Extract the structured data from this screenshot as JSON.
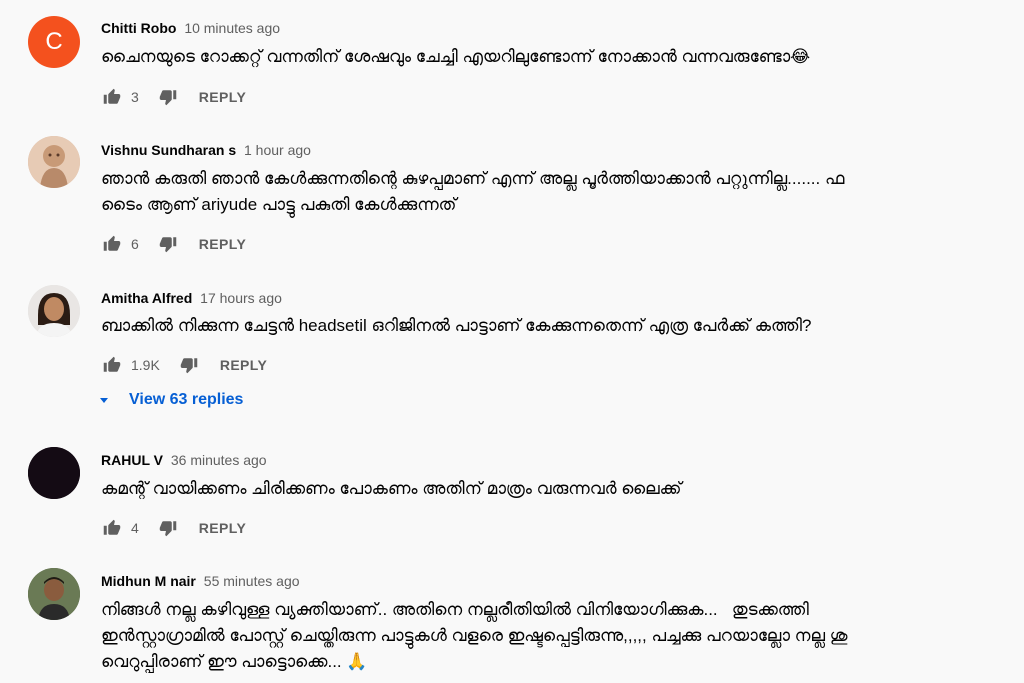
{
  "comments": [
    {
      "avatar_letter": "C",
      "author": "Chitti Robo",
      "time": "10 minutes ago",
      "text": "ചൈനയുടെ റോക്കറ്റ് വന്നതിന് ശേഷവും ചേച്ചി എയറിലുണ്ടോന്ന് നോക്കാൻ വന്നവരുണ്ടോ😂",
      "likes": "3",
      "reply_label": "REPLY"
    },
    {
      "author": "Vishnu Sundharan s",
      "time": "1 hour ago",
      "text": "ഞാൻ കരുതി ഞാൻ കേൾക്കുന്നതിന്റെ കുഴപ്പമാണ് എന്ന് അല്ല പൂർത്തിയാക്കാൻ പറ്റുന്നില്ല....... ഫ\nടൈം ആണ് ariyude പാട്ടു പകുതി കേൾക്കുന്നത്",
      "likes": "6",
      "reply_label": "REPLY"
    },
    {
      "author": "Amitha Alfred",
      "time": "17 hours ago",
      "text": "ബാക്കിൽ നിക്കുന്ന ചേട്ടൻ headsetil ഒറിജിനൽ പാട്ടാണ് കേക്കുന്നതെന്ന് എത്ര പേർക്ക് കത്തി?",
      "likes": "1.9K",
      "reply_label": "REPLY",
      "view_replies": "View 63 replies"
    },
    {
      "author": "RAHUL V",
      "time": "36 minutes ago",
      "text": "കമന്റ് വായിക്കണം ചിരിക്കണം പോകണം അതിന് മാത്രം വരുന്നവർ ലൈക്ക്",
      "likes": "4",
      "reply_label": "REPLY"
    },
    {
      "author": "Midhun M nair",
      "time": "55 minutes ago",
      "text": "നിങ്ങൾ നല്ല കഴിവുള്ള വ്യക്തിയാണ്.. അതിനെ നല്ലരീതിയിൽ വിനിയോഗിക്കുക...   തുടക്കത്തി\nഇൻസ്റ്റാഗ്രാമിൽ പോസ്റ്റ് ചെയ്തിരുന്ന പാട്ടുകൾ വളരെ ഇഷ്ടപ്പെട്ടിരുന്നു,,,,, പച്ചക്കു പറയാല്ലോ നല്ല ശു\nവെറുപ്പിരാണ് ഈ പാട്ടൊക്കെ... 🙏",
      "likes": "",
      "reply_label": ""
    }
  ],
  "colors": {
    "link": "#065fd4",
    "secondary_text": "#606060",
    "avatar_c": "#f4511e"
  }
}
